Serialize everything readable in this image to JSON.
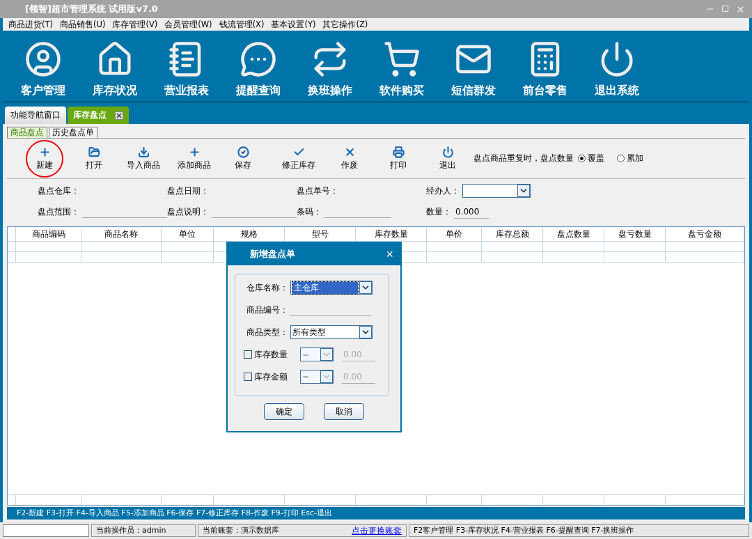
{
  "window": {
    "title": "[领智]超市管理系统 试用版v7.0"
  },
  "menu": [
    "商品进货(T)",
    "商品销售(U)",
    "库存管理(V)",
    "会员管理(W)",
    "钱流管理(X)",
    "基本设置(Y)",
    "其它操作(Z)"
  ],
  "nav": [
    {
      "kind": "user",
      "label": "客户管理"
    },
    {
      "kind": "house",
      "label": "库存状况"
    },
    {
      "kind": "notepad",
      "label": "营业报表"
    },
    {
      "kind": "chat",
      "label": "提醒查询"
    },
    {
      "kind": "swap",
      "label": "换班操作"
    },
    {
      "kind": "cart",
      "label": "软件购买"
    },
    {
      "kind": "mail",
      "label": "短信群发"
    },
    {
      "kind": "register",
      "label": "前台零售"
    },
    {
      "kind": "power",
      "label": "退出系统"
    }
  ],
  "tabs": [
    {
      "label": "功能导航窗口",
      "selected": false,
      "closable": false
    },
    {
      "label": "库存盘点",
      "selected": true,
      "closable": true
    }
  ],
  "subtabs": [
    {
      "label": "商品盘点",
      "selected": true
    },
    {
      "label": "历史盘点单",
      "selected": false
    }
  ],
  "toolbar": [
    {
      "kind": "plus",
      "label": "新建",
      "highlighted": true
    },
    {
      "kind": "folder",
      "label": "打开",
      "highlighted": false
    },
    {
      "kind": "import",
      "label": "导入商品",
      "highlighted": false
    },
    {
      "kind": "plus",
      "label": "添加商品",
      "highlighted": false
    },
    {
      "kind": "save",
      "label": "保存",
      "highlighted": false
    },
    {
      "kind": "check",
      "label": "修正库存",
      "highlighted": false
    },
    {
      "kind": "x",
      "label": "作废",
      "highlighted": false
    },
    {
      "kind": "print",
      "label": "打印",
      "highlighted": false
    },
    {
      "kind": "power",
      "label": "退出",
      "highlighted": false
    }
  ],
  "duplicate_option": {
    "label": "盘点商品重复时，盘点数量",
    "choices": [
      {
        "label": "覆盖",
        "selected": true
      },
      {
        "label": "累加",
        "selected": false
      }
    ]
  },
  "form_rows": [
    [
      {
        "label": "盘点仓库：",
        "kind": "plain"
      },
      {
        "label": "盘点日期：",
        "kind": "plain"
      },
      {
        "label": "盘点单号：",
        "kind": "plain"
      },
      {
        "label": "经办人：",
        "kind": "select"
      }
    ],
    [
      {
        "label": "盘点范围：",
        "kind": "line"
      },
      {
        "label": "盘点说明：",
        "kind": "line"
      },
      {
        "label": "条码：",
        "kind": "line"
      },
      {
        "label": "数量：",
        "kind": "value",
        "value": "0.000"
      }
    ]
  ],
  "table": {
    "columns": [
      "商品编码",
      "商品名称",
      "单位",
      "规格",
      "型号",
      "库存数量",
      "单价",
      "库存总额",
      "盘点数量",
      "盘亏数量",
      "盘亏金额"
    ]
  },
  "shortcut_bar": "F2-新建 F3-打开 F4-导入商品 F5-添加商品 F6-保存 F7-修正库存 F8-作废 F9-打印 Esc-退出",
  "status_bar": {
    "operator": "当前操作员：admin",
    "account": "当前账套：演示数据库",
    "link": "点击更换账套",
    "hotkeys": "F2客户管理 F3-库存状况 F4-营业报表 F6-提醒查询 F7-换班操作"
  },
  "dialog": {
    "title": "新增盘点单",
    "close": "×",
    "fields": [
      {
        "kind": "select",
        "label": "仓库名称：",
        "value": "主仓库",
        "focused": true
      },
      {
        "kind": "line",
        "label": "商品编号："
      },
      {
        "kind": "select",
        "label": "商品类型：",
        "value": "所有类型",
        "focused": false
      },
      {
        "kind": "check",
        "label": "库存数量",
        "checked": false,
        "operator": "=",
        "value": "0.00"
      },
      {
        "kind": "check",
        "label": "库存金额",
        "checked": false,
        "operator": "=",
        "value": "0.00"
      }
    ],
    "buttons": [
      "确定",
      "取消"
    ]
  }
}
